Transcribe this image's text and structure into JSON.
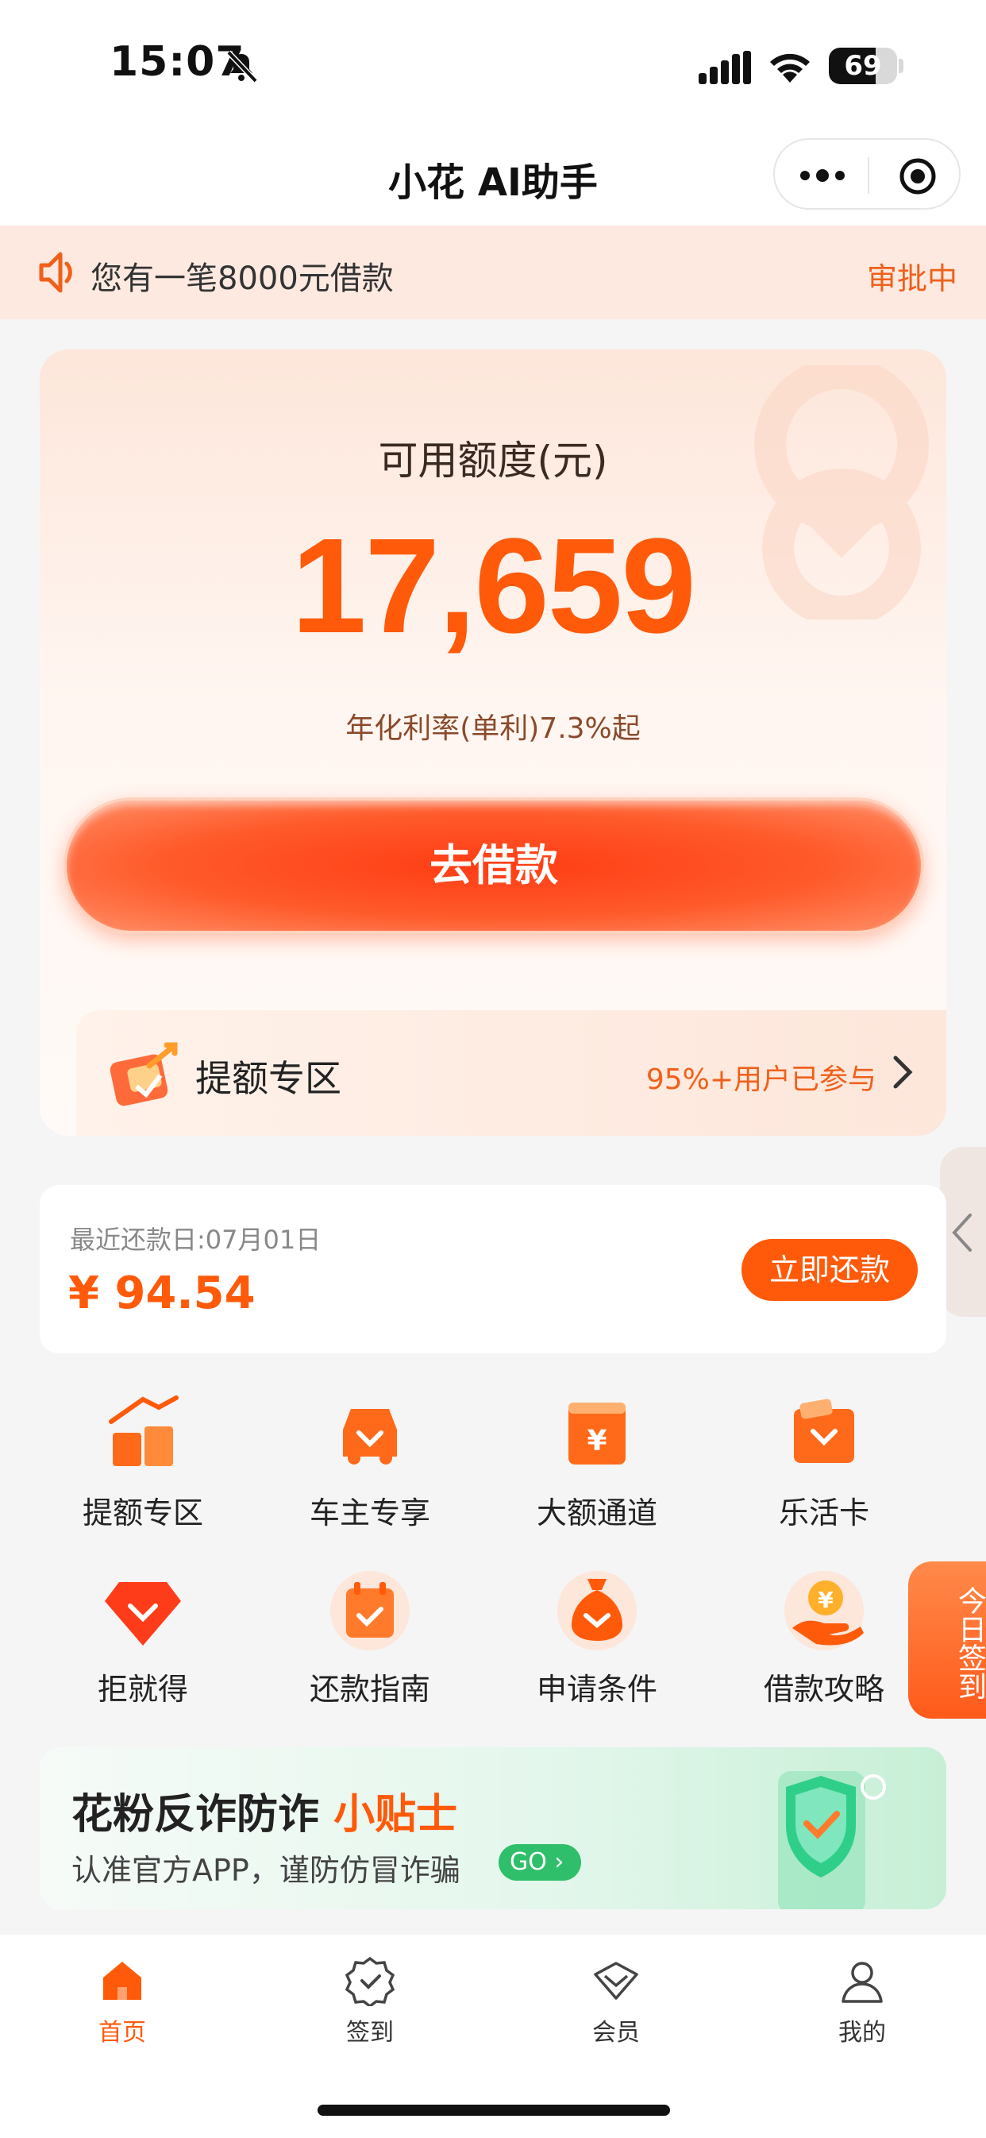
{
  "status_bar": {
    "time": "15:07",
    "battery": "69"
  },
  "nav": {
    "title": "小花 AI助手"
  },
  "notice": {
    "message": "您有一笔8000元借款",
    "status": "审批中"
  },
  "credit": {
    "label": "可用额度(元)",
    "amount": "17,659",
    "rate": "年化利率(单利)7.3%起",
    "borrow_button": "去借款",
    "boost_label": "提额专区",
    "boost_tip": "95%+用户已参与"
  },
  "repay": {
    "date": "最近还款日:07月01日",
    "amount": "¥ 94.54",
    "button": "立即还款"
  },
  "grid": [
    {
      "label": "提额专区",
      "icon": "boost-icon"
    },
    {
      "label": "车主专享",
      "icon": "car-icon"
    },
    {
      "label": "大额通道",
      "icon": "large-amount-icon"
    },
    {
      "label": "乐活卡",
      "icon": "card-icon"
    },
    {
      "label": "拒就得",
      "icon": "diamond-icon"
    },
    {
      "label": "还款指南",
      "icon": "calendar-icon"
    },
    {
      "label": "申请条件",
      "icon": "money-bag-icon"
    },
    {
      "label": "借款攻略",
      "icon": "coin-hand-icon"
    }
  ],
  "checkin": {
    "label": "今日签到"
  },
  "banner": {
    "title_main": "花粉反诈防诈",
    "title_highlight": "小贴士",
    "subtitle": "认准官方APP，谨防仿冒诈骗",
    "go": "GO"
  },
  "tabs": [
    {
      "label": "首页",
      "icon": "home-icon",
      "active": true
    },
    {
      "label": "签到",
      "icon": "check-badge-icon",
      "active": false
    },
    {
      "label": "会员",
      "icon": "vip-icon",
      "active": false
    },
    {
      "label": "我的",
      "icon": "user-icon",
      "active": false
    }
  ],
  "colors": {
    "accent": "#ff5a0a",
    "notice_bg": "#fde9e0",
    "page_bg": "#f5f5f5"
  }
}
